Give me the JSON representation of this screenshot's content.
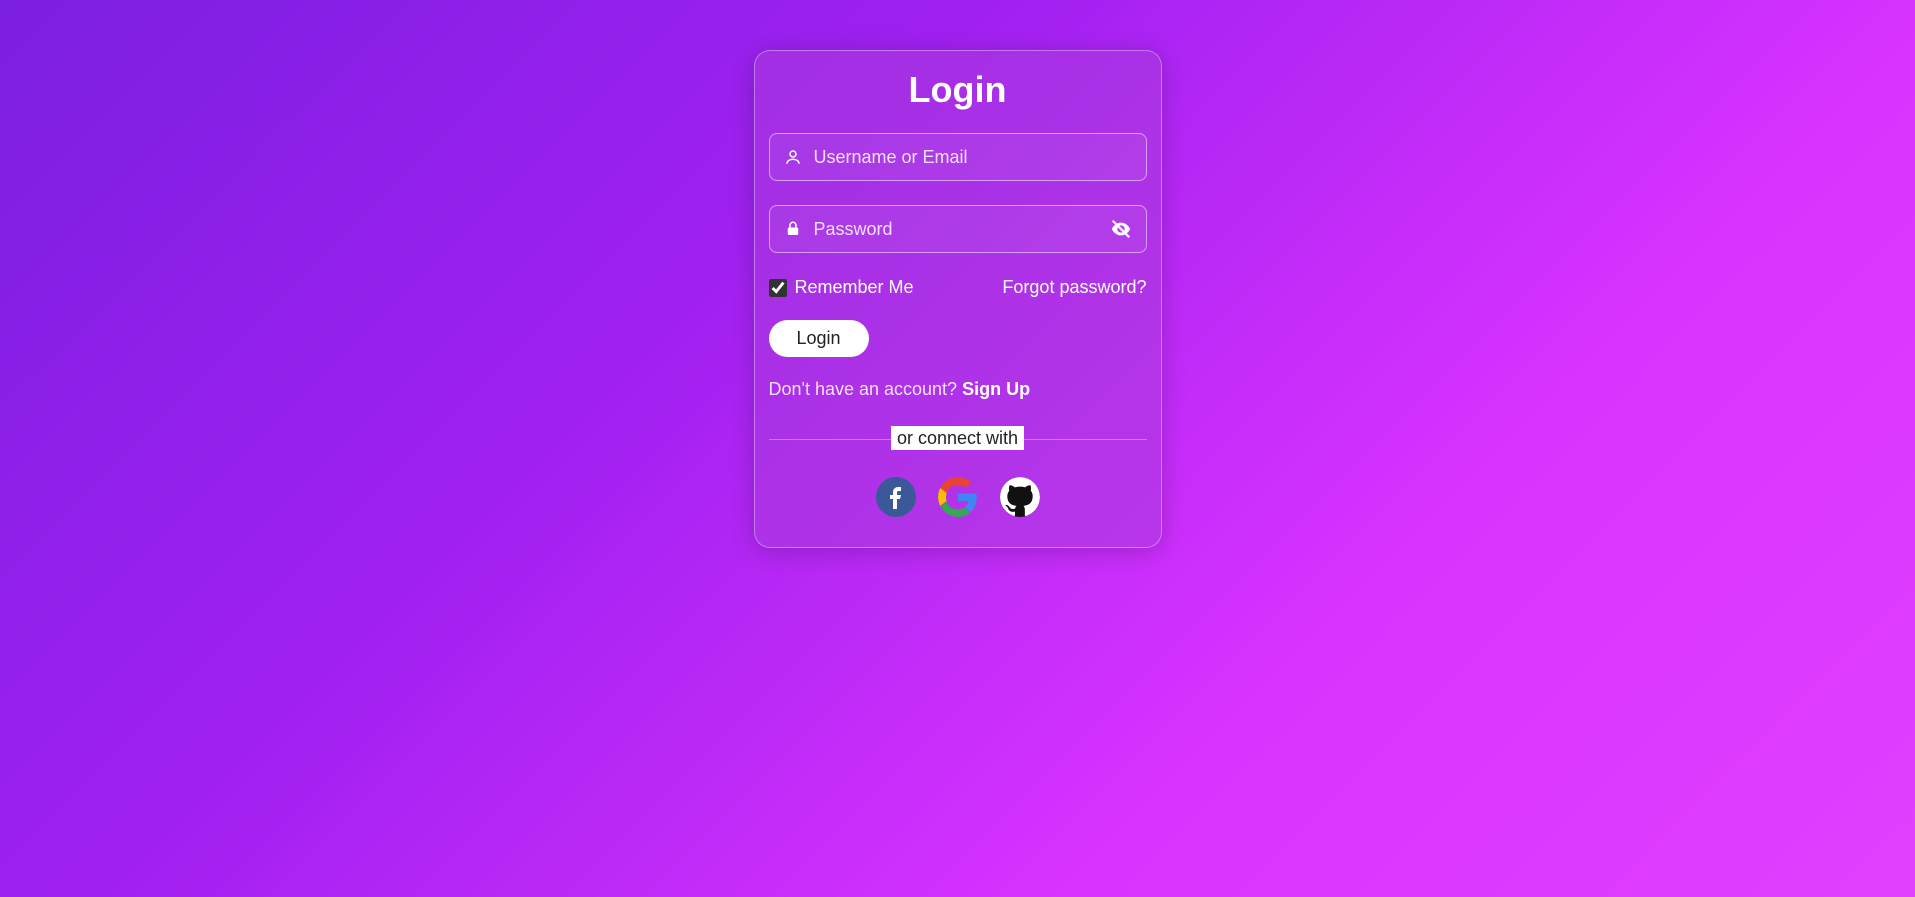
{
  "title": "Login",
  "username": {
    "placeholder": "Username or Email",
    "value": ""
  },
  "password": {
    "placeholder": "Password",
    "value": ""
  },
  "remember": {
    "label": "Remember Me",
    "checked": true
  },
  "forgot_label": "Forgot password?",
  "login_button": "Login",
  "signup": {
    "prefix": "Don't have an account? ",
    "link": "Sign Up"
  },
  "divider_text": "or connect with",
  "social": {
    "facebook": "facebook-icon",
    "google": "google-icon",
    "github": "github-icon"
  }
}
